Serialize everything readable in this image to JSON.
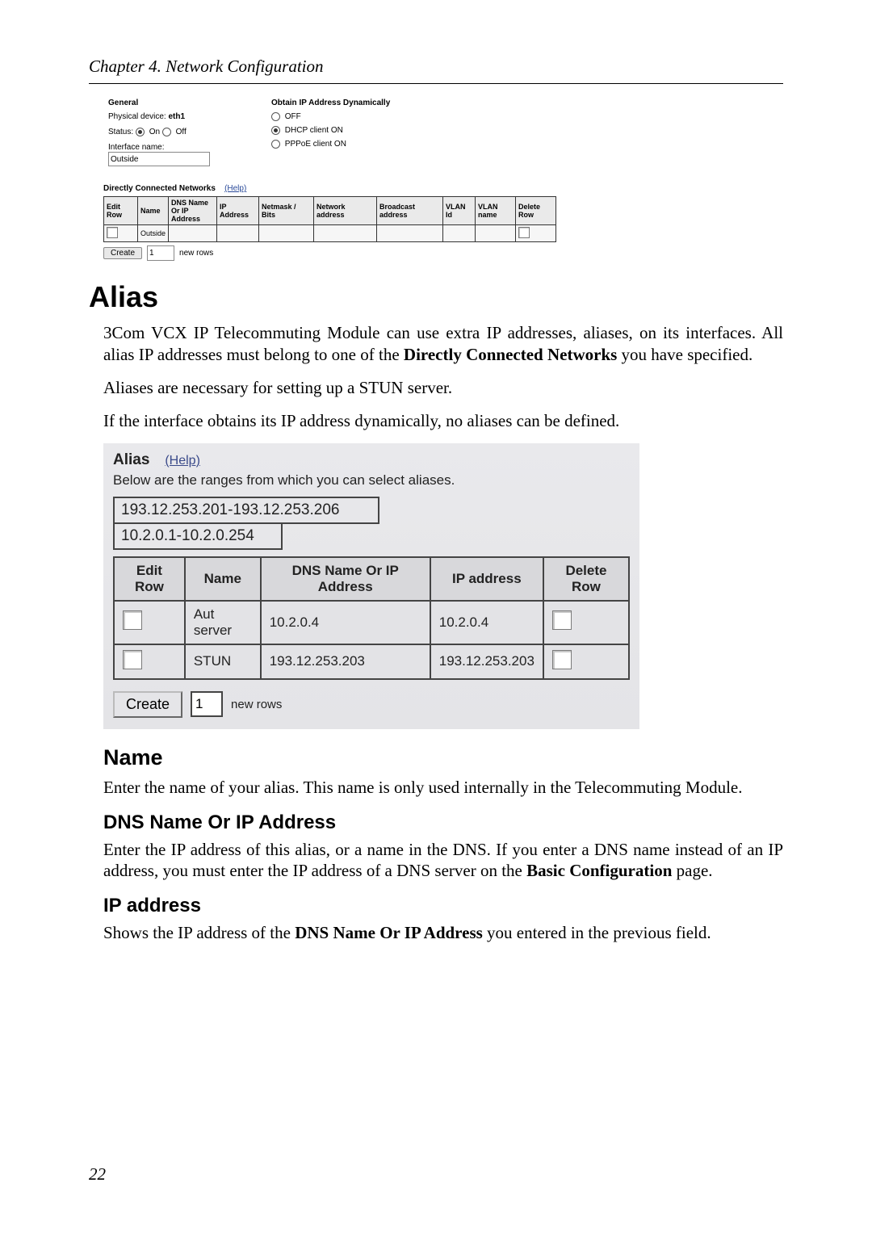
{
  "chapter_header": "Chapter 4. Network Configuration",
  "top_panel": {
    "general_heading": "General",
    "physical_device_label": "Physical device:",
    "physical_device_value": "eth1",
    "status_label": "Status:",
    "status_on": "On",
    "status_off": "Off",
    "interface_name_label": "Interface name:",
    "interface_name_value": "Outside",
    "dynamic_heading": "Obtain IP Address Dynamically",
    "opt_off": "OFF",
    "opt_dhcp": "DHCP client ON",
    "opt_pppoe": "PPPoE client ON",
    "dcn_heading": "Directly Connected Networks",
    "help": "(Help)",
    "dcn_headers": [
      "Edit Row",
      "Name",
      "DNS Name Or IP Address",
      "IP Address",
      "Netmask / Bits",
      "Network address",
      "Broadcast address",
      "VLAN Id",
      "VLAN name",
      "Delete Row"
    ],
    "dcn_row_name": "Outside",
    "create": "Create",
    "create_qty": "1",
    "new_rows": "new rows"
  },
  "alias_heading": "Alias",
  "alias_p1_a": "3Com VCX IP Telecommuting Module can use extra IP addresses, aliases, on its interfaces. All alias IP addresses must belong to one of the ",
  "alias_p1_b": "Directly Connected Networks",
  "alias_p1_c": " you have specified.",
  "alias_p2": "Aliases are necessary for setting up a STUN server.",
  "alias_p3": "If the interface obtains its IP address dynamically, no aliases can be defined.",
  "alias_panel": {
    "title": "Alias",
    "help": "(Help)",
    "desc": "Below are the ranges from which you can select aliases.",
    "range1": "193.12.253.201-193.12.253.206",
    "range2": "10.2.0.1-10.2.0.254",
    "headers": {
      "edit": "Edit Row",
      "name": "Name",
      "dns": "DNS Name Or IP Address",
      "ip": "IP address",
      "del": "Delete Row"
    },
    "rows": [
      {
        "name": "Aut server",
        "dns": "10.2.0.4",
        "ip": "10.2.0.4"
      },
      {
        "name": "STUN",
        "dns": "193.12.253.203",
        "ip": "193.12.253.203"
      }
    ],
    "create": "Create",
    "create_qty": "1",
    "new_rows": "new rows"
  },
  "name_h": "Name",
  "name_p": "Enter the name of your alias. This name is only used internally in the Telecommuting Module.",
  "dns_h": "DNS Name Or IP Address",
  "dns_p_a": "Enter the IP address of this alias, or a name in the DNS. If you enter a DNS name instead of an IP address, you must enter the IP address of a DNS server on the ",
  "dns_p_b": "Basic Configuration",
  "dns_p_c": " page.",
  "ip_h": "IP address",
  "ip_p_a": "Shows the IP address of the ",
  "ip_p_b": "DNS Name Or IP Address",
  "ip_p_c": " you entered in the previous field.",
  "page_number": "22"
}
